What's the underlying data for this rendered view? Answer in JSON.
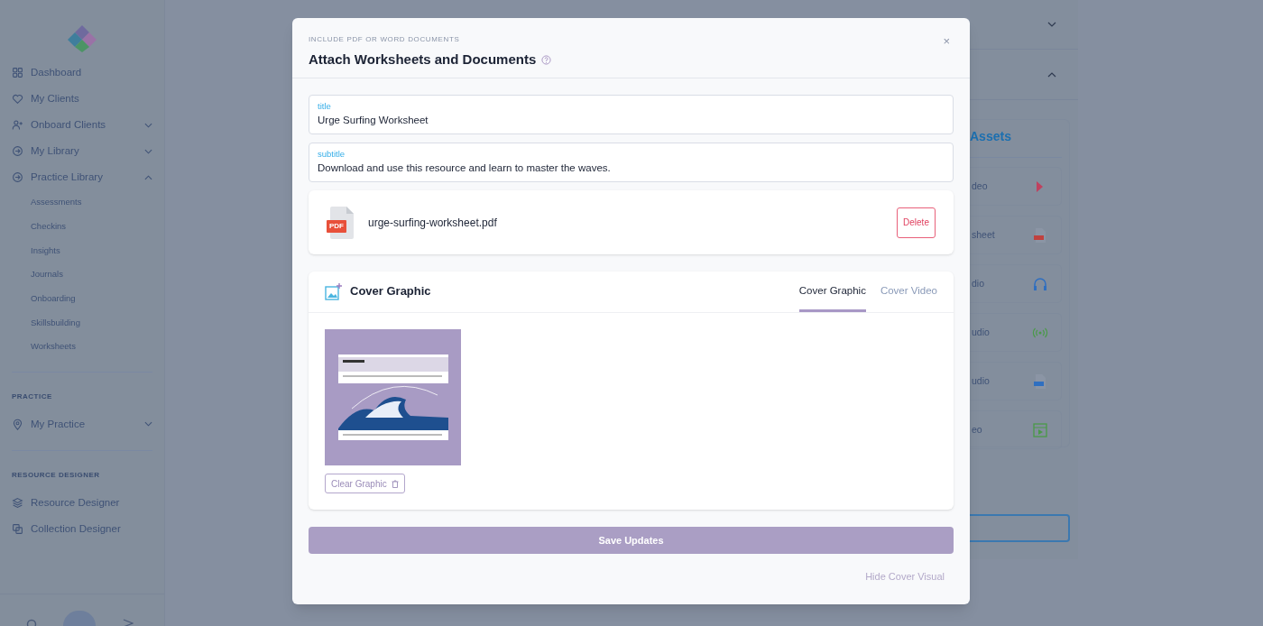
{
  "sidebar": {
    "sections": [
      {
        "items": [
          {
            "label": "Dashboard",
            "expandable": false,
            "expanded": false
          },
          {
            "label": "My Clients",
            "expandable": false,
            "expanded": false
          },
          {
            "label": "Onboard Clients",
            "expandable": true,
            "expanded": false
          },
          {
            "label": "My Library",
            "expandable": true,
            "expanded": false
          },
          {
            "label": "Practice Library",
            "expandable": true,
            "expanded": true,
            "children": [
              {
                "label": "Assessments"
              },
              {
                "label": "Checkins"
              },
              {
                "label": "Insights"
              },
              {
                "label": "Journals"
              },
              {
                "label": "Onboarding"
              },
              {
                "label": "Skillsbuilding"
              },
              {
                "label": "Worksheets"
              }
            ]
          }
        ]
      },
      {
        "heading": "PRACTICE",
        "items": [
          {
            "label": "My Practice",
            "expandable": true,
            "expanded": false
          }
        ]
      },
      {
        "heading": "RESOURCE DESIGNER",
        "items": [
          {
            "label": "Resource Designer",
            "expandable": false,
            "expanded": false
          },
          {
            "label": "Collection Designer",
            "expandable": false,
            "expanded": false
          }
        ]
      }
    ]
  },
  "background_panel": {
    "heading": "Assets",
    "items": [
      {
        "label": "deo"
      },
      {
        "label": "sheet"
      },
      {
        "label": "dio"
      },
      {
        "label": "udio"
      },
      {
        "label": "udio"
      },
      {
        "label": "eo"
      }
    ]
  },
  "modal": {
    "eyebrow": "INCLUDE PDF OR WORD DOCUMENTS",
    "title": "Attach Worksheets and Documents",
    "close": "×",
    "fields": [
      {
        "label": "title",
        "value": "Urge Surfing Worksheet"
      },
      {
        "label": "subtitle",
        "value": "Download and use this resource and learn to master the waves."
      }
    ],
    "attachment": {
      "file_badge": "PDF",
      "filename": "urge-surfing-worksheet.pdf",
      "delete_label": "Delete"
    },
    "cover": {
      "title": "Cover Graphic",
      "tabs": [
        {
          "label": "Cover Graphic",
          "selected": true
        },
        {
          "label": "Cover Video",
          "selected": false
        }
      ],
      "clear_label": "Clear Graphic"
    },
    "save_label": "Save Updates",
    "hide_label": "Hide Cover Visual"
  }
}
